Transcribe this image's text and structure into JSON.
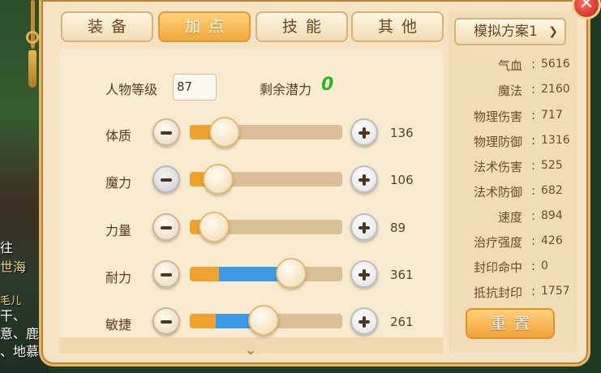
{
  "tabs": [
    {
      "label": "装备",
      "active": false
    },
    {
      "label": "加点",
      "active": true
    },
    {
      "label": "技能",
      "active": false
    },
    {
      "label": "其他",
      "active": false
    }
  ],
  "level": {
    "label": "人物等级",
    "value": "87"
  },
  "potential": {
    "label": "剩余潜力",
    "value": "0"
  },
  "attributes": [
    {
      "label": "体质",
      "value": "136"
    },
    {
      "label": "魔力",
      "value": "106"
    },
    {
      "label": "力量",
      "value": "89"
    },
    {
      "label": "耐力",
      "value": "361"
    },
    {
      "label": "敏捷",
      "value": "261"
    }
  ],
  "scheme": {
    "label": "模拟方案1"
  },
  "stats": [
    {
      "label": "气血",
      "value": "5616"
    },
    {
      "label": "魔法",
      "value": "2160"
    },
    {
      "label": "物理伤害",
      "value": "717"
    },
    {
      "label": "物理防御",
      "value": "1316"
    },
    {
      "label": "法术伤害",
      "value": "525"
    },
    {
      "label": "法术防御",
      "value": "682"
    },
    {
      "label": "速度",
      "value": "894"
    },
    {
      "label": "治疗强度",
      "value": "426"
    },
    {
      "label": "封印命中",
      "value": "0"
    },
    {
      "label": "抵抗封印",
      "value": "1757"
    }
  ],
  "stat_colon": ":",
  "reset_button": "重置",
  "icons": {
    "close": "close-icon",
    "dropdown": "chevron-down-icon",
    "expand": "chevron-down-icon"
  },
  "background_text": [
    "往",
    "世海",
    "毛儿",
    "干、",
    "意、鹿",
    "、地慕"
  ],
  "colors": {
    "accent": "#f0a83c",
    "potential": "#27b71c",
    "fill_blue": "#3b9be8",
    "fill_orange": "#f0a230"
  }
}
